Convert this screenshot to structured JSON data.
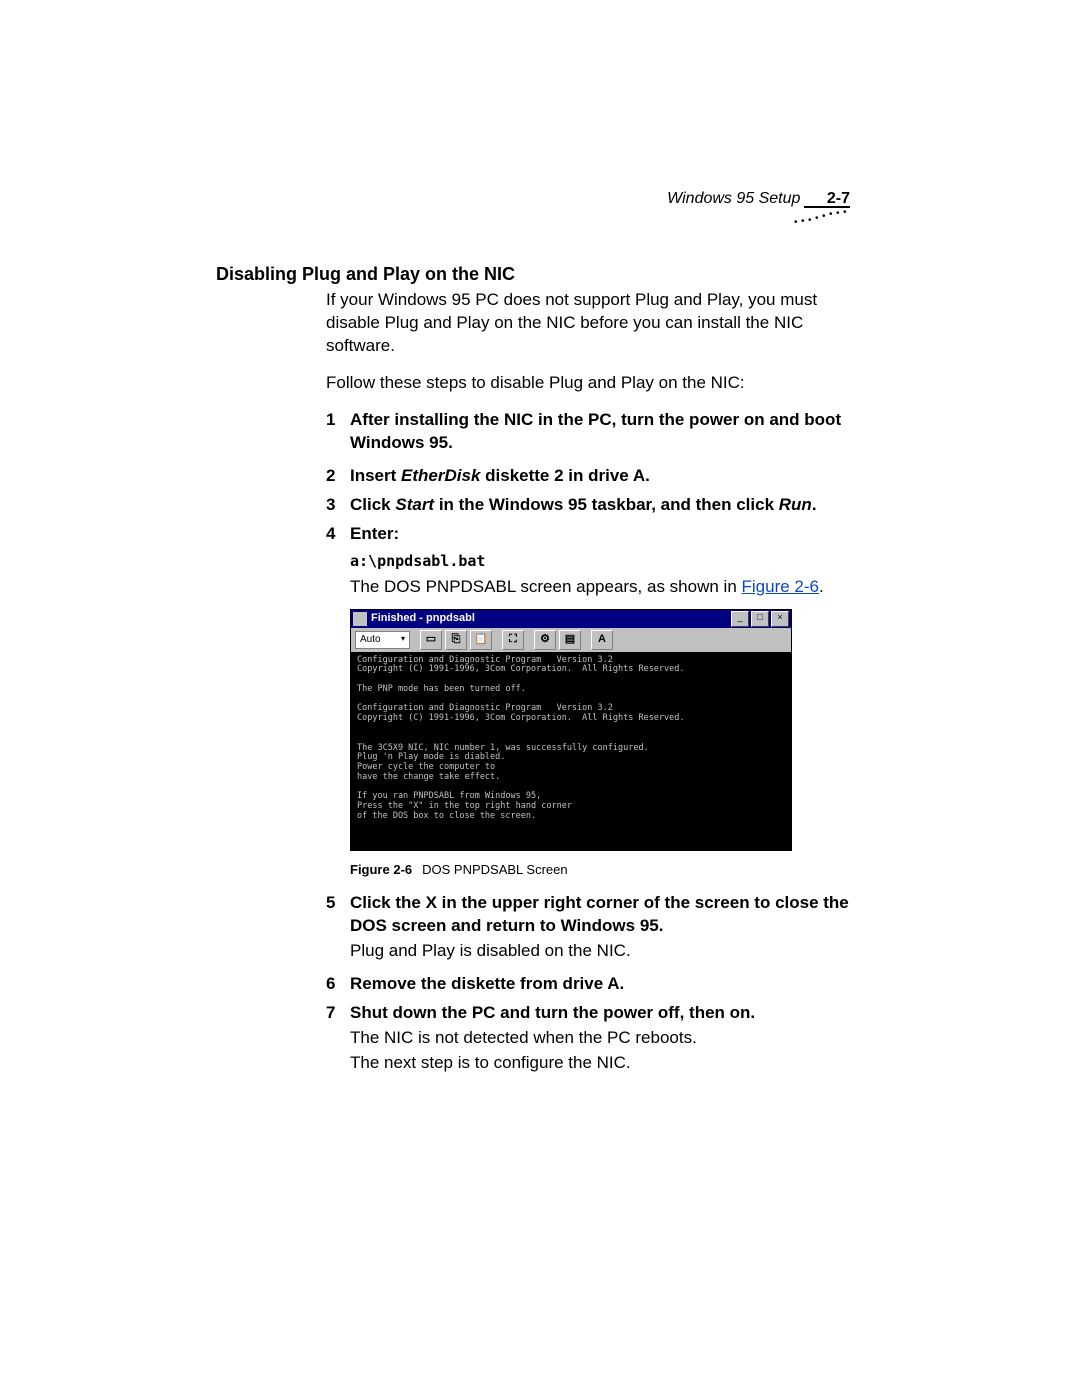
{
  "header": {
    "chapter": "Windows 95 Setup",
    "page": "2-7"
  },
  "section_title": "Disabling Plug and Play on the NIC",
  "intro1": "If your Windows 95 PC does not support Plug and Play, you must disable Plug and Play on the NIC before you can install the NIC software.",
  "intro2": "Follow these steps to disable Plug and Play on the NIC:",
  "steps": {
    "s1": "After installing the NIC in the PC, turn the power on and boot Windows 95.",
    "s2_pre": "Insert ",
    "s2_em": "EtherDisk",
    "s2_post": " diskette 2 in drive A.",
    "s3_pre": "Click ",
    "s3_em1": "Start",
    "s3_mid": " in the Windows 95 taskbar, and then click ",
    "s3_em2": "Run",
    "s3_post": ".",
    "s4": "Enter:",
    "s4_cmd": "a:\\pnpdsabl.bat",
    "s4_body_pre": "The DOS PNPDSABL screen appears, as shown in ",
    "s4_body_link": "Figure 2-6",
    "s4_body_post": ".",
    "s5": "Click the X in the upper right corner of the screen to close the DOS screen and return to Windows 95.",
    "s5_body": "Plug and Play is disabled on the NIC.",
    "s6": "Remove the diskette from drive A.",
    "s7": "Shut down the PC and turn the power off, then on.",
    "s7_body1": "The NIC is not detected when the PC reboots.",
    "s7_body2": "The next step is to configure the NIC."
  },
  "figure": {
    "window_title": "Finished - pnpdsabl",
    "combo": "Auto",
    "font_btn": "A",
    "console_text": "Configuration and Diagnostic Program   Version 3.2\nCopyright (C) 1991-1996, 3Com Corporation.  All Rights Reserved.\n\nThe PNP mode has been turned off.\n\nConfiguration and Diagnostic Program   Version 3.2\nCopyright (C) 1991-1996, 3Com Corporation.  All Rights Reserved.\n\n\nThe 3C5X9 NIC, NIC number 1, was successfully configured.\nPlug 'n Play mode is diabled.\nPower cycle the computer to\nhave the change take effect.\n\nIf you ran PNPDSABL from Windows 95,\nPress the \"X\" in the top right hand corner\nof the DOS box to close the screen.",
    "caption_label": "Figure 2-6",
    "caption_text": "DOS PNPDSABL Screen"
  }
}
